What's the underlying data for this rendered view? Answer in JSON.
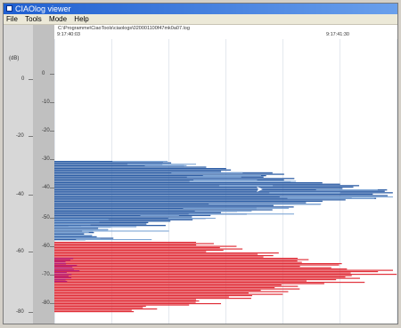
{
  "window": {
    "title": "CIAOlog viewer"
  },
  "menu": [
    "File",
    "Tools",
    "Mode",
    "Help"
  ],
  "path_text": "C:\\Programme\\CiaoTools\\ciaologs\\020001100f47mk0a07.log",
  "time_labels": {
    "left": "9:17:40:03",
    "right": "9:17:41:30"
  },
  "y_axis": {
    "unit": "(dB)",
    "outer_ticks": [
      "0",
      "-20",
      "-40",
      "-60",
      "-80"
    ],
    "inner_ticks": [
      "0",
      "-10",
      "-20",
      "-30",
      "-40",
      "-50",
      "-60",
      "-70",
      "-80"
    ]
  },
  "colors": {
    "blue_series": "#2f5fa6",
    "light_blue_series": "#7ea6d6",
    "red_series": "#e0303a",
    "magenta_highlight": "#b81e7a"
  }
}
